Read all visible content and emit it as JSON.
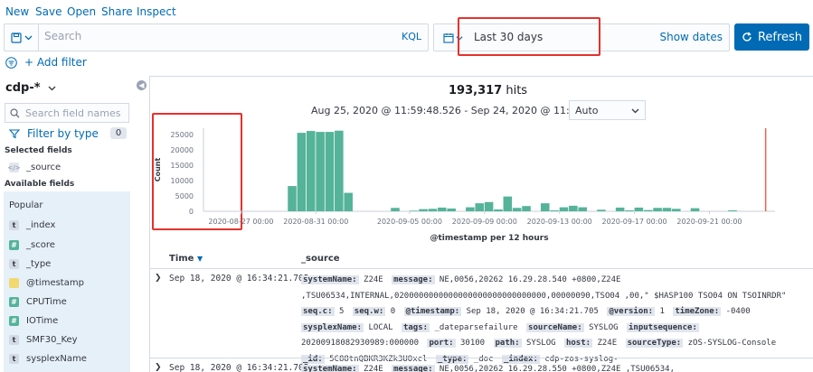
{
  "topmenu": {
    "new": "New",
    "save": "Save",
    "open": "Open",
    "share": "Share",
    "inspect": "Inspect"
  },
  "query": {
    "placeholder": "Search",
    "language": "KQL"
  },
  "timepicker": {
    "range": "Last 30 days",
    "show_dates": "Show dates"
  },
  "refresh_label": "Refresh",
  "add_filter": "+ Add filter",
  "index_pattern": "cdp-*",
  "field_search_placeholder": "Search field names",
  "filter_by_type": "Filter by type",
  "filter_count": "0",
  "selected_fields_title": "Selected fields",
  "selected_fields": [
    {
      "type": "src",
      "token": "</>",
      "name": "_source"
    }
  ],
  "available_fields_title": "Available fields",
  "popular_title": "Popular",
  "fields": [
    {
      "type": "str",
      "token": "t",
      "name": "_index"
    },
    {
      "type": "num",
      "token": "#",
      "name": "_score"
    },
    {
      "type": "str",
      "token": "t",
      "name": "_type"
    },
    {
      "type": "date",
      "token": "",
      "name": "@timestamp"
    },
    {
      "type": "num",
      "token": "#",
      "name": "CPUTime"
    },
    {
      "type": "num",
      "token": "#",
      "name": "IOTime"
    },
    {
      "type": "str",
      "token": "t",
      "name": "SMF30_Key"
    },
    {
      "type": "str",
      "token": "t",
      "name": "sysplexName"
    },
    {
      "type": "str",
      "token": "t",
      "name": "systemName"
    }
  ],
  "hits_count": "193,317",
  "hits_label": "hits",
  "date_range_text": "Aug 25, 2020 @ 11:59:48.526 - Sep 24, 2020 @ 11:59:48.526",
  "interval": "Auto",
  "chart_data": {
    "type": "bar",
    "ylabel": "Count",
    "xlabel": "@timestamp per 12 hours",
    "ylim": [
      0,
      27000
    ],
    "yticks": [
      0,
      5000,
      10000,
      15000,
      20000,
      25000
    ],
    "xtick_labels": [
      "2020-08-27 00:00",
      "2020-08-31 00:00",
      "2020-09-05 00:00",
      "2020-09-09 00:00",
      "2020-09-13 00:00",
      "2020-09-17 00:00",
      "2020-09-21 00:00"
    ],
    "xtick_days": [
      2,
      6,
      11,
      15,
      19,
      23,
      27
    ],
    "x_start": "2020-08-25 00:00",
    "x_end": "2020-09-24 12:00",
    "now_marker_day": 30,
    "bar_color": "#54b399",
    "marker_color": "#e7664c",
    "bars": [
      {
        "d": 4.5,
        "v": 8200
      },
      {
        "d": 5,
        "v": 25500
      },
      {
        "d": 5.5,
        "v": 26100
      },
      {
        "d": 6,
        "v": 25800
      },
      {
        "d": 6.5,
        "v": 25800
      },
      {
        "d": 7,
        "v": 26200
      },
      {
        "d": 7.5,
        "v": 6000
      },
      {
        "d": 10,
        "v": 1100
      },
      {
        "d": 11,
        "v": 200
      },
      {
        "d": 11.5,
        "v": 700
      },
      {
        "d": 12,
        "v": 800
      },
      {
        "d": 12.5,
        "v": 1200
      },
      {
        "d": 13,
        "v": 900
      },
      {
        "d": 14,
        "v": 1300
      },
      {
        "d": 14.5,
        "v": 2600
      },
      {
        "d": 15,
        "v": 3000
      },
      {
        "d": 15.5,
        "v": 600
      },
      {
        "d": 16,
        "v": 4800
      },
      {
        "d": 16.5,
        "v": 1100
      },
      {
        "d": 17,
        "v": 1700
      },
      {
        "d": 18,
        "v": 2600
      },
      {
        "d": 18.5,
        "v": 300
      },
      {
        "d": 19,
        "v": 1300
      },
      {
        "d": 19.5,
        "v": 1800
      },
      {
        "d": 20,
        "v": 1300
      },
      {
        "d": 21,
        "v": 500
      },
      {
        "d": 22,
        "v": 1200
      },
      {
        "d": 22.5,
        "v": 300
      },
      {
        "d": 23,
        "v": 1200
      },
      {
        "d": 23.5,
        "v": 400
      },
      {
        "d": 24,
        "v": 1100
      },
      {
        "d": 24.5,
        "v": 1100
      },
      {
        "d": 25,
        "v": 800
      },
      {
        "d": 26,
        "v": 1000
      },
      {
        "d": 28,
        "v": 300
      }
    ]
  },
  "table": {
    "col_time": "Time",
    "col_source": "_source",
    "rows": [
      {
        "time": "Sep 18, 2020 @ 16:34:21.705",
        "fields": [
          {
            "k": "systemName:",
            "v": "Z24E"
          },
          {
            "k": "message:",
            "v": "NE,0056,20262 16.29.28.540 +0800,Z24E ,TSU06534,INTERNAL,0200000000000000000000000000000,00000090,TSO04 ,00,\" $HASP100 TSO04 ON TSOINRDR\""
          },
          {
            "k": "seq.c:",
            "v": "5"
          },
          {
            "k": "seq.w:",
            "v": "0"
          },
          {
            "k": "@timestamp:",
            "v": "Sep 18, 2020 @ 16:34:21.705"
          },
          {
            "k": "@version:",
            "v": "1"
          },
          {
            "k": "timeZone:",
            "v": "-0400"
          },
          {
            "k": "sysplexName:",
            "v": "LOCAL"
          },
          {
            "k": "tags:",
            "v": "_dateparsefailure"
          },
          {
            "k": "sourceName:",
            "v": "SYSLOG"
          },
          {
            "k": "inputsequence:",
            "v": "20200918082930989:000000"
          },
          {
            "k": "port:",
            "v": "30100"
          },
          {
            "k": "path:",
            "v": "SYSLOG"
          },
          {
            "k": "host:",
            "v": "Z24E"
          },
          {
            "k": "sourceType:",
            "v": "zOS-SYSLOG-Console"
          },
          {
            "k": "_id:",
            "v": "5C88tnQBKR3KZk3UOxcl"
          },
          {
            "k": "_type:",
            "v": "_doc"
          },
          {
            "k": "_index:",
            "v": "cdp-zos-syslog-"
          }
        ]
      },
      {
        "time": "Sep 18, 2020 @ 16:34:21.705",
        "fields": [
          {
            "k": "systemName:",
            "v": "Z24E"
          },
          {
            "k": "message:",
            "v": "NE,0056,20262 16.29.28.550 +0800,Z24E ,TSU06534,"
          }
        ]
      }
    ]
  }
}
